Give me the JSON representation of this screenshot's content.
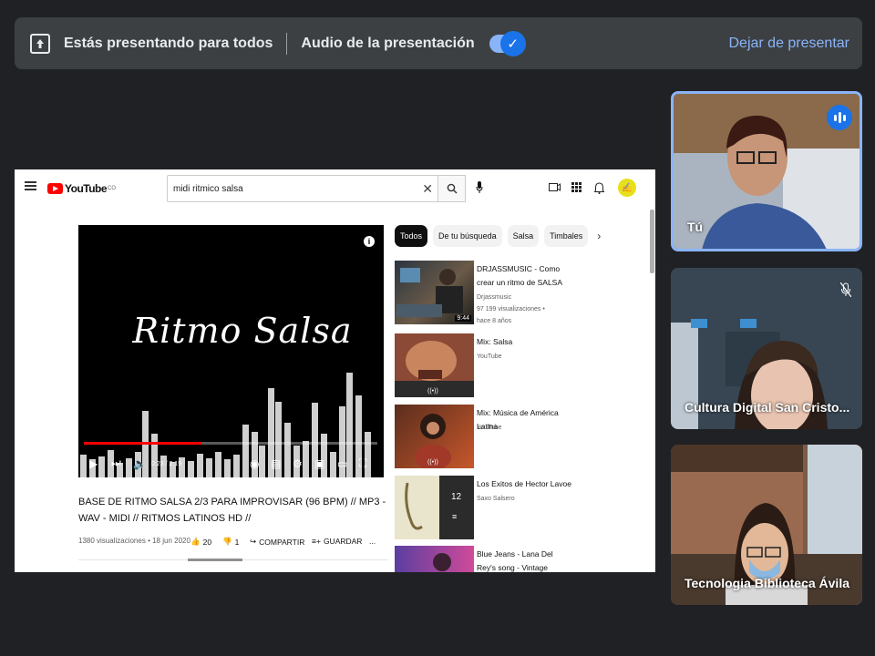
{
  "top_bar": {
    "presenting_text": "Estás presentando para todos",
    "audio_label": "Audio de la presentación",
    "audio_enabled": true,
    "stop_label": "Dejar de presentar",
    "icons": [
      "present-screen-icon",
      "check-icon"
    ]
  },
  "youtube": {
    "logo_text": "YouTube",
    "logo_region": "CO",
    "search_value": "midi ritmico salsa",
    "video": {
      "overlay_title": "Ritmo Salsa",
      "time": "0:23 / 2:19",
      "progress": 0.4,
      "title": "BASE DE RITMO SALSA 2/3 PARA IMPROVISAR (96 BPM) // MP3 - WAV - MIDI // RITMOS LATINOS HD //",
      "views": "1380 visualizaciones",
      "date": "18 jun 2020",
      "likes": "20",
      "dislikes": "1",
      "share_label": "COMPARTIR",
      "save_label": "GUARDAR",
      "more_label": "..."
    },
    "chips": [
      "Todos",
      "De tu búsqueda",
      "Salsa",
      "Timbales"
    ],
    "recommendations": [
      {
        "title": "DRJASSMUSIC - Como crear un ritmo de SALSA",
        "channel": "Drjassmusic",
        "views": "97 199 visualizaciones •",
        "age": "hace 8 años",
        "duration": "9:44"
      },
      {
        "title": "Mix: Salsa",
        "channel": "YouTube"
      },
      {
        "title": "Mix: Música de América Latina",
        "channel": "YouTube"
      },
      {
        "title": "Los Exitos de Hector Lavoe",
        "channel": "Saxo Salsero",
        "playlist_count": "12"
      },
      {
        "title": "Blue Jeans - Lana Del Rey's song - Vintage Reggae Café ..."
      }
    ]
  },
  "participants": [
    {
      "name": "Tú",
      "speaking": true
    },
    {
      "name": "Cultura Digital San Cristo...",
      "muted": true
    },
    {
      "name": "Tecnologia Biblioteca Ávila"
    }
  ]
}
